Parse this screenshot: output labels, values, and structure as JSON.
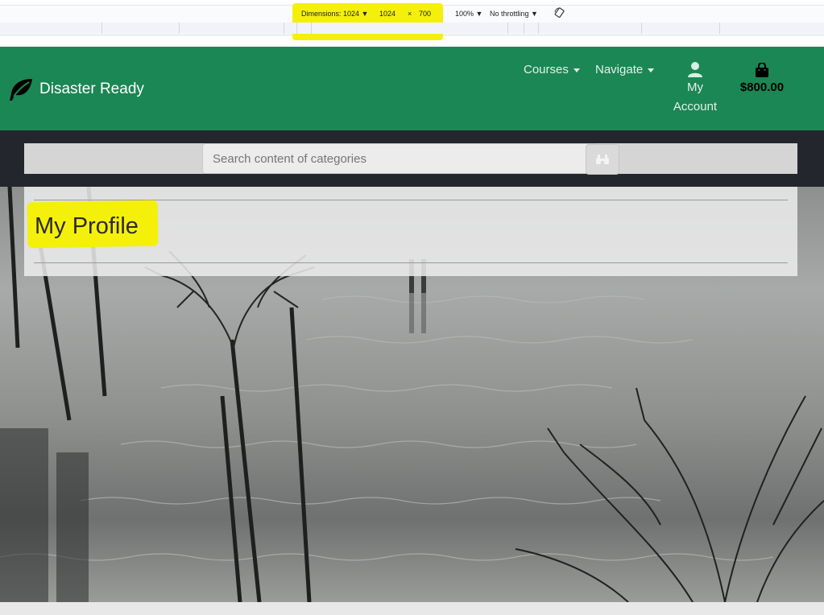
{
  "devtools": {
    "dimensions_label": "Dimensions: 1024 ▼",
    "width_value": "1024",
    "times_sign": "×",
    "height_value": "700",
    "zoom": "100% ▼",
    "throttling": "No throttling ▼"
  },
  "navbar": {
    "brand_name": "Disaster Ready",
    "brand_icon": "leaf-icon",
    "items": [
      {
        "label": "Courses"
      },
      {
        "label": "Navigate"
      }
    ],
    "account_label_line1": "My",
    "account_label_line2": "Account",
    "cart_total": "$800.00",
    "brand_color": "#1b8754"
  },
  "search": {
    "placeholder": "Search content of categories",
    "button_icon": "binoculars-icon"
  },
  "profile": {
    "title": "My Profile"
  },
  "colors": {
    "highlight": "#f5f00a",
    "navbar": "#1b8754",
    "search_band": "#23262d"
  }
}
